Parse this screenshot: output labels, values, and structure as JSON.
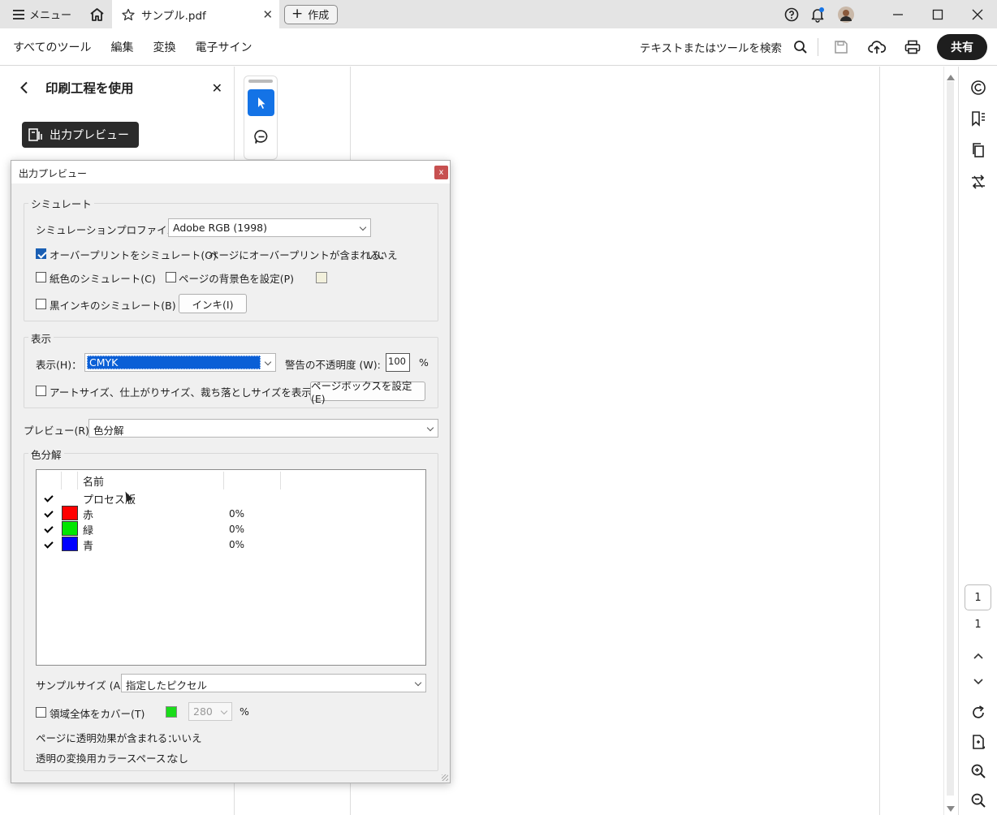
{
  "titlebar": {
    "menu_label": "メニュー",
    "tab_title": "サンプル.pdf",
    "tab_close": "✕",
    "create_label": "作成",
    "create_plus": "+"
  },
  "toolbar": {
    "menus": [
      "すべてのツール",
      "編集",
      "変換",
      "電子サイン"
    ],
    "search_label": "テキストまたはツールを検索",
    "share_label": "共有"
  },
  "left_panel": {
    "title": "印刷工程を使用",
    "close": "✕",
    "output_preview_button": "出力プレビュー"
  },
  "dialog": {
    "title": "出力プレビュー",
    "close": "x",
    "simulate": {
      "group_label": "シミュレート",
      "profile_label": "シミュレーションプロファイル(S)：",
      "profile_value": "Adobe RGB (1998)",
      "overprint_label": "オーバープリントをシミュレート(O)",
      "overprint_checked": true,
      "page_overprint_label": "ページにオーバープリントが含まれる：",
      "page_overprint_value": "いいえ",
      "paper_color_label": "紙色のシミュレート(C)",
      "bg_color_label": "ページの背景色を設定(P)",
      "black_ink_label": "黒インキのシミュレート(B)",
      "ink_button": "インキ(I)",
      "bg_swatch_color": "#f2f0dc"
    },
    "display": {
      "group_label": "表示",
      "show_label": "表示(H)：",
      "show_value": "CMYK",
      "warn_opacity_label": "警告の不透明度 (W):",
      "warn_opacity_value": "100",
      "percent": "%",
      "art_size_label": "アートサイズ、仕上がりサイズ、裁ち落としサイズを表示(X)",
      "page_box_button": "ページボックスを設定(E)"
    },
    "preview": {
      "label": "プレビュー(R)：",
      "value": "色分解"
    },
    "separations": {
      "group_label": "色分解",
      "col_name": "名前",
      "rows": [
        {
          "name": "プロセス版",
          "pct": "",
          "color": ""
        },
        {
          "name": "赤",
          "pct": "0%",
          "color": "#ff0000"
        },
        {
          "name": "緑",
          "pct": "0%",
          "color": "#00e600"
        },
        {
          "name": "青",
          "pct": "0%",
          "color": "#0000ff"
        }
      ],
      "sample_size_label": "サンプルサイズ (A):",
      "sample_size_value": "指定したピクセル",
      "cover_area_label": "領域全体をカバー(T)",
      "cover_color": "#1adc1a",
      "cover_value": "280",
      "cover_percent": "%",
      "transparency_label": "ページに透明効果が含まれる：",
      "transparency_value": "いいえ",
      "blend_space_label": "透明の変換用カラースペース：",
      "blend_space_value": "なし"
    }
  },
  "right_rail": {
    "page_current": "1",
    "page_total": "1"
  }
}
